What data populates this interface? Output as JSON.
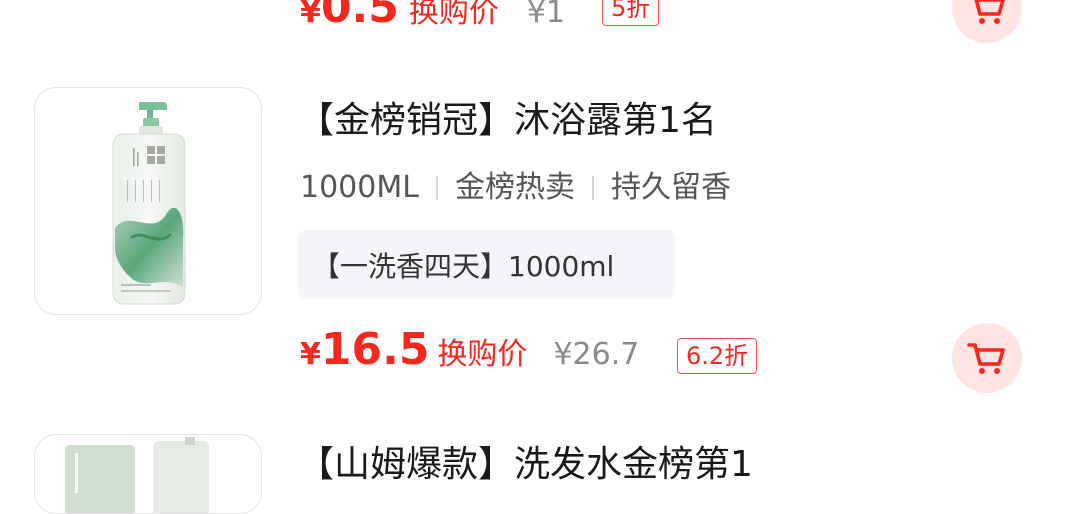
{
  "top_item": {
    "yen": "¥",
    "price": "0.5",
    "price_label": "换购价",
    "original_price": "¥1",
    "discount": "5折"
  },
  "main_item": {
    "title": "【金榜销冠】沐浴露第1名",
    "tags": [
      "1000ML",
      "金榜热卖",
      "持久留香"
    ],
    "spec": "【一洗香四天】1000ml",
    "yen": "¥",
    "price": "16.5",
    "price_label": "换购价",
    "original_price": "¥26.7",
    "discount": "6.2折"
  },
  "bottom_item": {
    "title": "【山姆爆款】洗发水金榜第1"
  },
  "colors": {
    "price_red": "#f5281e",
    "cart_bg": "#ffe4e1",
    "chip_bg": "#f4f5f9"
  },
  "icons": {
    "cart": "shopping-cart-icon"
  }
}
